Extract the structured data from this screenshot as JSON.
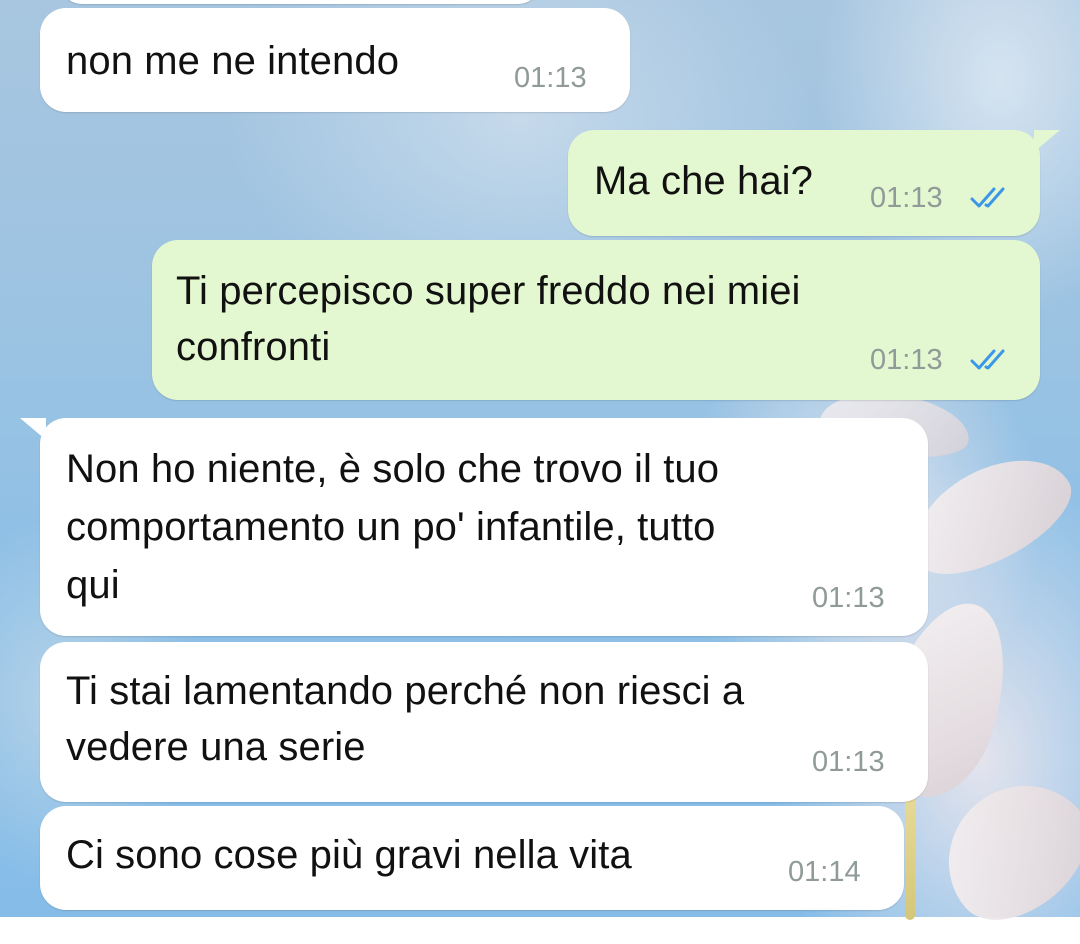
{
  "chat": {
    "messages": [
      {
        "direction": "incoming",
        "text": "non me ne intendo",
        "time": "01:13"
      },
      {
        "direction": "outgoing",
        "text": "Ma che hai?",
        "time": "01:13",
        "status": "read-double-check"
      },
      {
        "direction": "outgoing",
        "lines": [
          "Ti percepisco super freddo nei miei",
          "confronti"
        ],
        "time": "01:13",
        "status": "read-double-check"
      },
      {
        "direction": "incoming",
        "lines": [
          "Non ho niente, è solo che trovo il tuo",
          "comportamento un po' infantile, tutto",
          "qui"
        ],
        "time": "01:13"
      },
      {
        "direction": "incoming",
        "lines": [
          "Ti stai lamentando perché non riesci a",
          "vedere una serie"
        ],
        "time": "01:13"
      },
      {
        "direction": "incoming",
        "text": "Ci sono cose più gravi nella vita",
        "time": "01:14"
      }
    ]
  },
  "colors": {
    "incoming_bubble": "#ffffff",
    "outgoing_bubble": "#e3f8d0",
    "timestamp": "#8f9a99",
    "read_ticks": "#3b97e8"
  },
  "icons": {
    "read_status": "double-check-icon"
  }
}
